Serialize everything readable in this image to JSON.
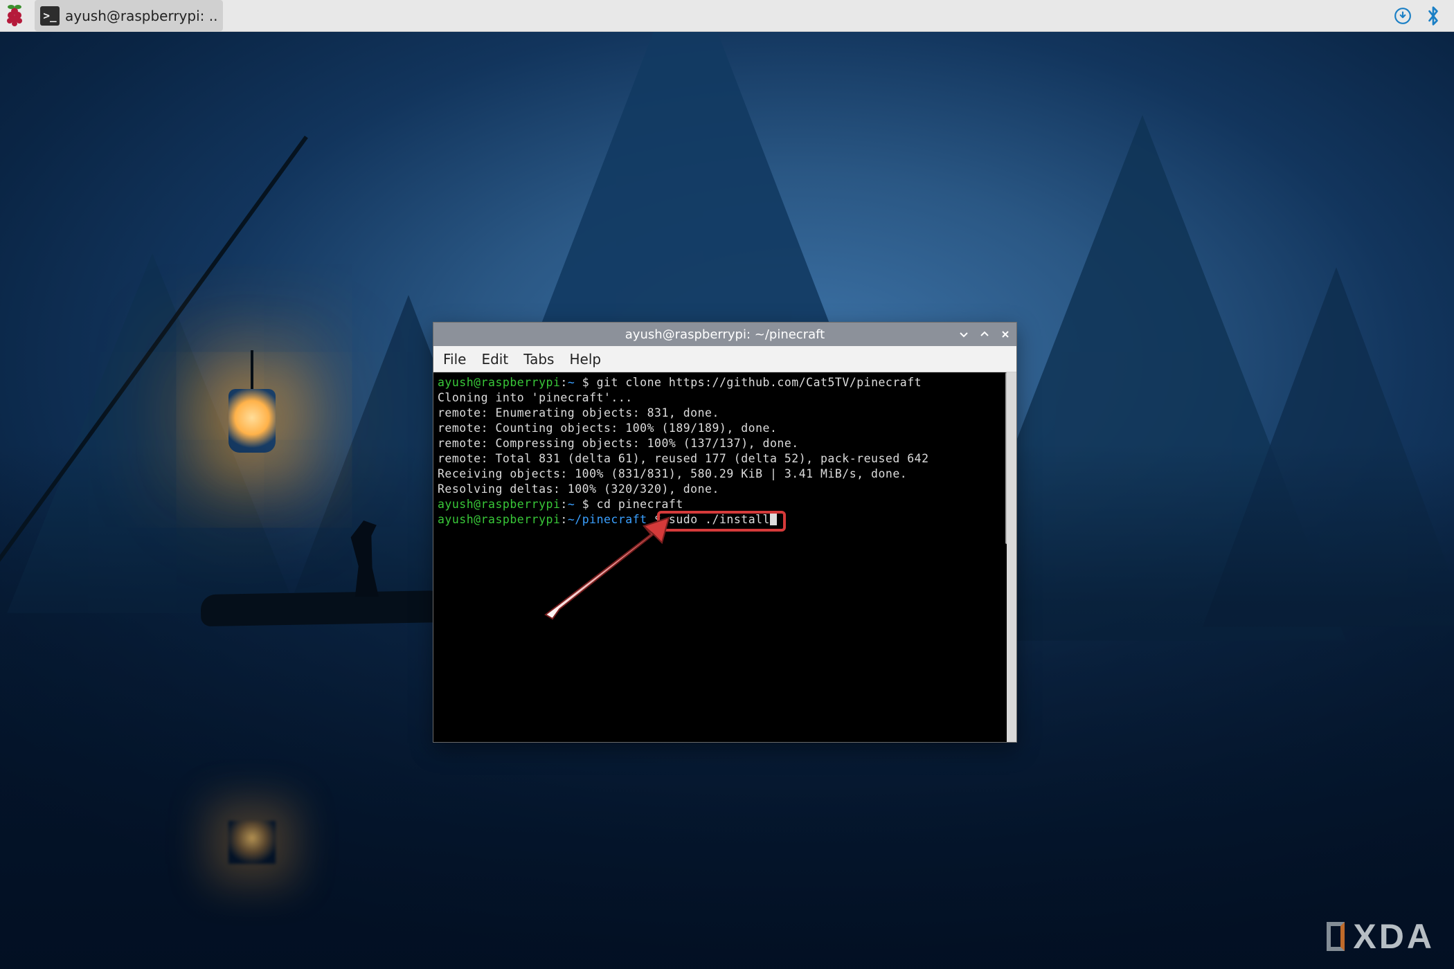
{
  "taskbar": {
    "active_app_title": "ayush@raspberrypi: ..",
    "terminal_glyph": ">_"
  },
  "tray": {
    "download_icon_name": "download-icon",
    "bluetooth_icon_name": "bluetooth-icon"
  },
  "terminal": {
    "title": "ayush@raspberrypi: ~/pinecraft",
    "menu": {
      "file": "File",
      "edit": "Edit",
      "tabs": "Tabs",
      "help": "Help"
    },
    "prompt1": {
      "user": "ayush",
      "at": "@",
      "host": "raspberrypi",
      "sep": ":",
      "path": "~",
      "dollar": "$",
      "command": "git clone https://github.com/Cat5TV/pinecraft"
    },
    "out1": "Cloning into 'pinecraft'...",
    "out2": "remote: Enumerating objects: 831, done.",
    "out3": "remote: Counting objects: 100% (189/189), done.",
    "out4": "remote: Compressing objects: 100% (137/137), done.",
    "out5": "remote: Total 831 (delta 61), reused 177 (delta 52), pack-reused 642",
    "out6": "Receiving objects: 100% (831/831), 580.29 KiB | 3.41 MiB/s, done.",
    "out7": "Resolving deltas: 100% (320/320), done.",
    "prompt2": {
      "user": "ayush",
      "at": "@",
      "host": "raspberrypi",
      "sep": ":",
      "path": "~",
      "dollar": "$",
      "command": "cd pinecraft"
    },
    "prompt3": {
      "user": "ayush",
      "at": "@",
      "host": "raspberrypi",
      "sep": ":",
      "path": "~/pinecraft",
      "dollar": "$",
      "command": "sudo ./install"
    }
  },
  "watermark": {
    "text": "XDA"
  },
  "colors": {
    "term_user_host": "#39c839",
    "term_path": "#3aa0ff",
    "annotation_red": "#d53a3a",
    "taskbar_bg": "#e8e8e8",
    "titlebar_bg": "#8c919a"
  }
}
